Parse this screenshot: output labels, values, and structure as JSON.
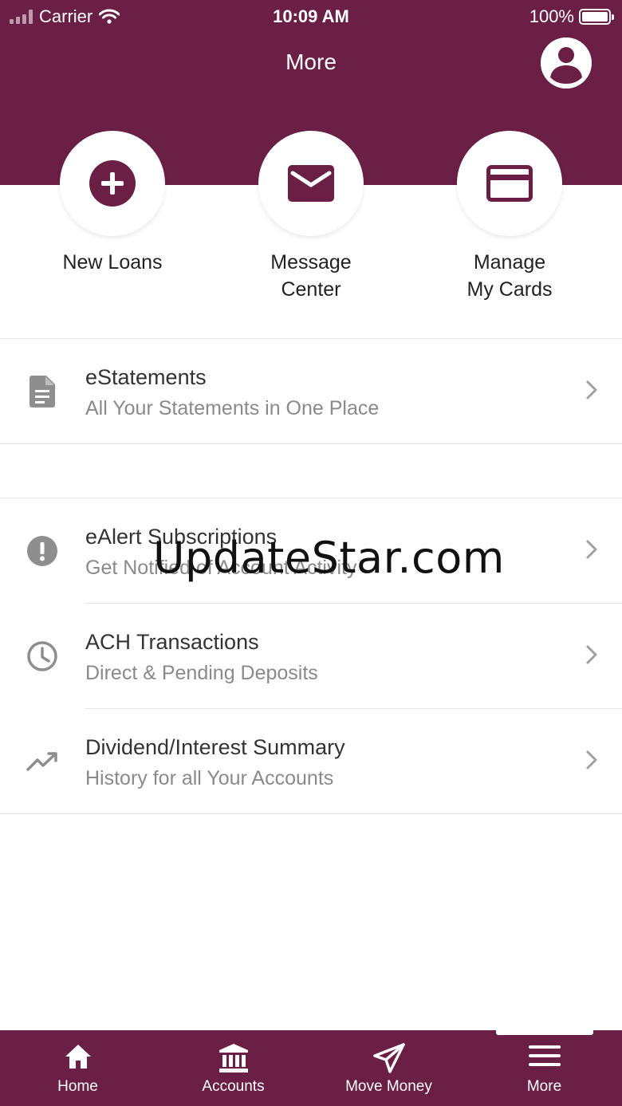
{
  "status_bar": {
    "carrier": "Carrier",
    "time": "10:09 AM",
    "battery": "100%"
  },
  "header": {
    "title": "More",
    "profile_icon": "profile-icon"
  },
  "colors": {
    "brand": "#6b1f45",
    "secondary_text": "#8a8a8a",
    "icon_gray": "#8e8e8e"
  },
  "quick_actions": [
    {
      "label": "New Loans",
      "icon": "plus-circle-icon"
    },
    {
      "label": "Message\nCenter",
      "icon": "envelope-icon"
    },
    {
      "label": "Manage\nMy Cards",
      "icon": "credit-card-icon"
    }
  ],
  "menu": [
    {
      "title": "eStatements",
      "subtitle": "All Your Statements in One Place",
      "icon": "document-icon"
    },
    {
      "title": "eAlert Subscriptions",
      "subtitle": "Get Notified of Account Activity",
      "icon": "alert-icon"
    },
    {
      "title": "ACH Transactions",
      "subtitle": "Direct & Pending Deposits",
      "icon": "clock-icon"
    },
    {
      "title": "Dividend/Interest Summary",
      "subtitle": "History for all Your Accounts",
      "icon": "trending-up-icon"
    }
  ],
  "watermark": "UpdateStar.com",
  "tabs": [
    {
      "label": "Home",
      "icon": "home-icon"
    },
    {
      "label": "Accounts",
      "icon": "bank-icon"
    },
    {
      "label": "Move Money",
      "icon": "send-icon"
    },
    {
      "label": "More",
      "icon": "menu-icon",
      "selected": true
    }
  ]
}
